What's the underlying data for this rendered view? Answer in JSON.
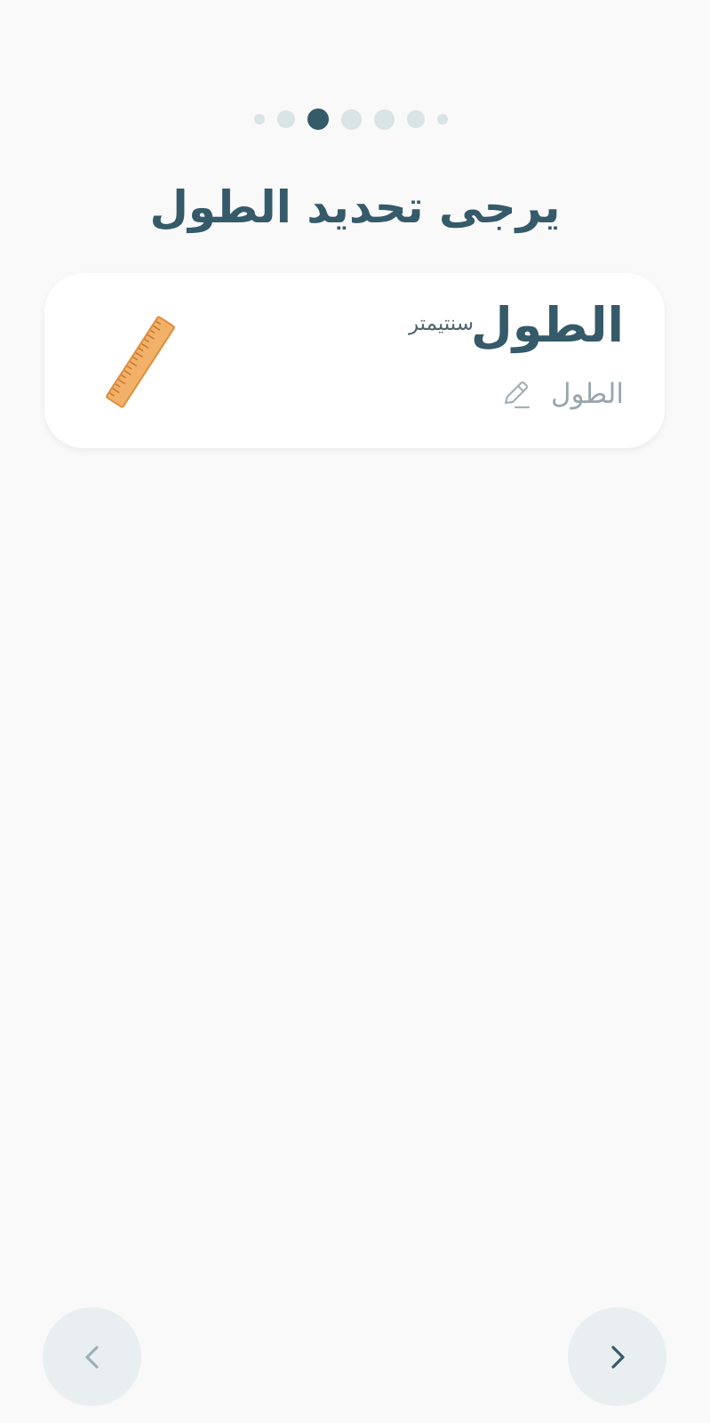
{
  "steps": {
    "total": 7,
    "current": 3
  },
  "page_title": "يرجى تحديد الطول",
  "card": {
    "title": "الطول",
    "unit": "سنتيمتر",
    "field_label": "الطول",
    "field_icon": "pencil-icon",
    "image_icon": "ruler-icon"
  },
  "navigation": {
    "prev_icon": "chevron-left-icon",
    "next_icon": "chevron-right-icon"
  },
  "colors": {
    "background": "#f9f9f9",
    "accent": "#355a69",
    "dot_inactive": "#d9e4e4",
    "card_background": "#ffffff",
    "nav_button_background": "#e9eff0",
    "muted_text": "#97a6ad"
  }
}
